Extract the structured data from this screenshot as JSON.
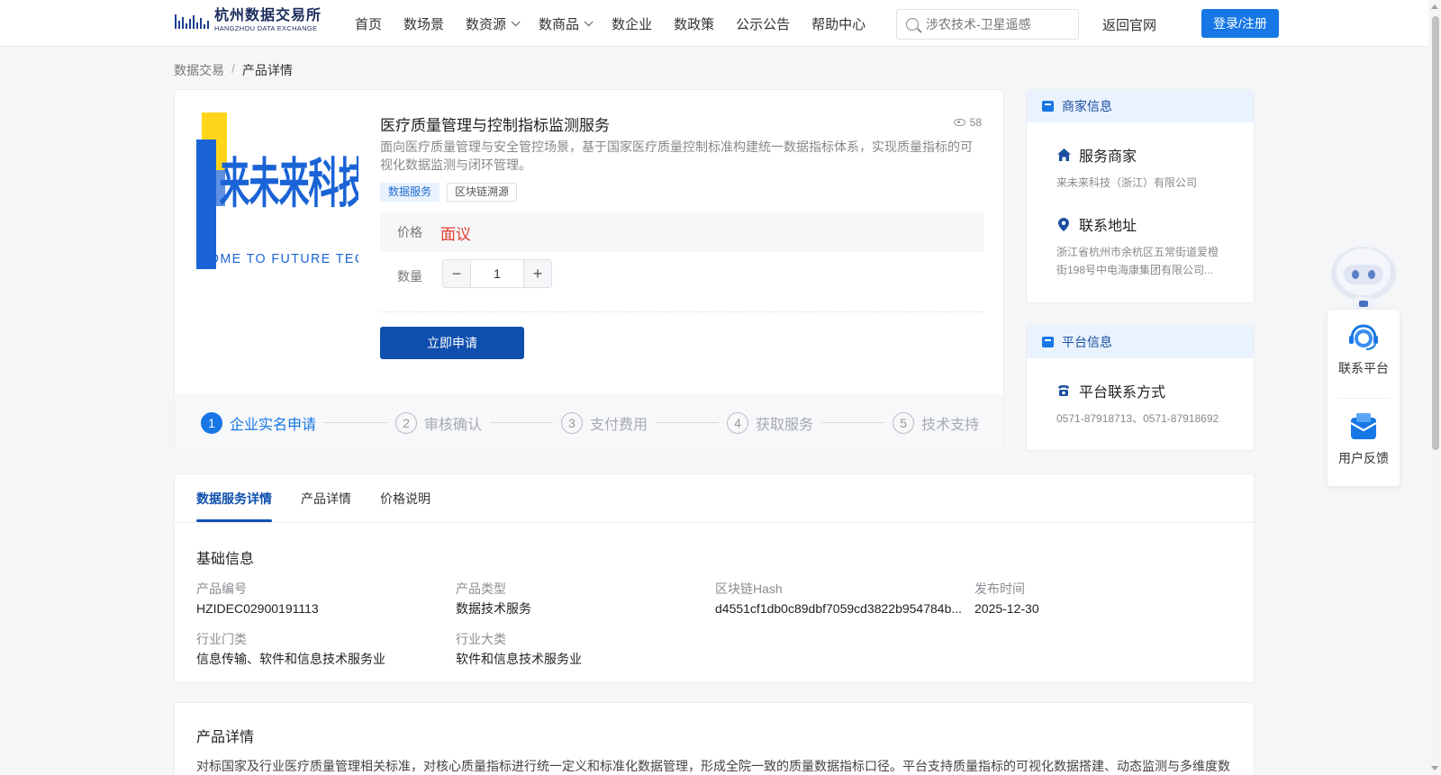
{
  "header": {
    "logo_cn": "杭州数据交易所",
    "logo_en": "HANGZHOU DATA EXCHANGE",
    "nav": [
      {
        "label": "首页",
        "dropdown": false
      },
      {
        "label": "数场景",
        "dropdown": false
      },
      {
        "label": "数资源",
        "dropdown": true
      },
      {
        "label": "数商品",
        "dropdown": true
      },
      {
        "label": "数企业",
        "dropdown": false
      },
      {
        "label": "数政策",
        "dropdown": false
      },
      {
        "label": "公示公告",
        "dropdown": false
      },
      {
        "label": "帮助中心",
        "dropdown": false
      }
    ],
    "search_placeholder": "涉农技术-卫星遥感",
    "back_link": "返回官网",
    "login_label": "登录/注册",
    "accent_color": "#1677e5"
  },
  "breadcrumb": {
    "root": "数据交易",
    "separator": "/",
    "current": "产品详情"
  },
  "product": {
    "logo_text_cn": "来未来科技",
    "logo_text_en": "COME TO FUTURE TECH",
    "title": "医疗质量管理与控制指标监测服务",
    "views": "58",
    "description": "面向医疗质量管理与安全管控场景，基于国家医疗质量控制标准构建统一数据指标体系，实现质量指标的可视化数据监测与闭环管理。",
    "tags": [
      "数据服务",
      "区块链溯源"
    ],
    "price_label": "价格",
    "price_value": "面议",
    "price_color": "#e23c2f",
    "quantity_label": "数量",
    "quantity_value": "1",
    "apply_label": "立即申请"
  },
  "steps": [
    {
      "num": "1",
      "label": "企业实名申请",
      "active": true
    },
    {
      "num": "2",
      "label": "审核确认",
      "active": false
    },
    {
      "num": "3",
      "label": "支付费用",
      "active": false
    },
    {
      "num": "4",
      "label": "获取服务",
      "active": false
    },
    {
      "num": "5",
      "label": "技术支持",
      "active": false
    }
  ],
  "merchant": {
    "heading": "商家信息",
    "provider_label": "服务商家",
    "provider_value": "来未来科技（浙江）有限公司",
    "address_label": "联系地址",
    "address_value": "浙江省杭州市余杭区五常街道爱橙街198号中电海康集团有限公司..."
  },
  "platform": {
    "heading": "平台信息",
    "contact_label": "平台联系方式",
    "contact_value": "0571-87918713、0571-87918692"
  },
  "detail_tabs": [
    {
      "label": "数据服务详情",
      "active": true
    },
    {
      "label": "产品详情",
      "active": false
    },
    {
      "label": "价格说明",
      "active": false
    }
  ],
  "basic_info": {
    "title": "基础信息",
    "fields": [
      {
        "key": "产品编号",
        "value": "HZIDEC02900191113"
      },
      {
        "key": "产品类型",
        "value": "数据技术服务"
      },
      {
        "key": "区块链Hash",
        "value": "d4551cf1db0c89dbf7059cd3822b954784b..."
      },
      {
        "key": "发布时间",
        "value": "2025-12-30"
      },
      {
        "key": "行业门类",
        "value": "信息传输、软件和信息技术服务业"
      },
      {
        "key": "行业大类",
        "value": "软件和信息技术服务业"
      }
    ]
  },
  "product_detail": {
    "title": "产品详情",
    "text": "对标国家及行业医疗质量管理相关标准，对核心质量指标进行统一定义和标准化数据管理，形成全院一致的质量数据指标口径。平台支持质量指标的可视化数据搭建、动态监测与多维度数"
  },
  "float_widget": {
    "contact_label": "联系平台",
    "feedback_label": "用户反馈"
  }
}
